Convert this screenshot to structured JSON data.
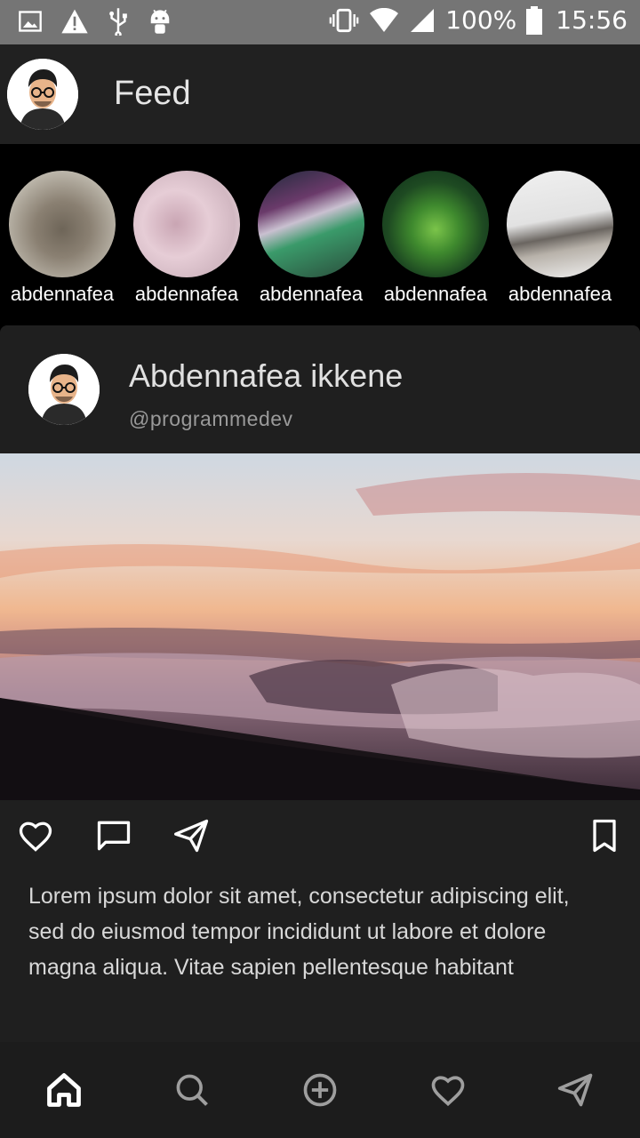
{
  "status_bar": {
    "battery": "100%",
    "time": "15:56",
    "left_icons": [
      "image-icon",
      "warning-icon",
      "usb-icon",
      "android-icon"
    ],
    "right_icons": [
      "vibrate-icon",
      "wifi-icon",
      "signal-icon",
      "battery-icon"
    ]
  },
  "app_bar": {
    "title": "Feed"
  },
  "stories": [
    {
      "name": "abdennafea"
    },
    {
      "name": "abdennafea"
    },
    {
      "name": "abdennafea"
    },
    {
      "name": "abdennafea"
    },
    {
      "name": "abdennafea"
    }
  ],
  "post": {
    "author": "Abdennafea ikkene",
    "handle": "@programmedev",
    "caption": "Lorem ipsum dolor sit amet, consectetur adipiscing elit, sed do eiusmod tempor incididunt ut labore et dolore magna aliqua. Vitae sapien pellentesque habitant",
    "actions": [
      "heart-icon",
      "comment-icon",
      "send-icon",
      "bookmark-icon"
    ]
  },
  "bottom_nav": [
    "home-icon",
    "search-icon",
    "add-icon",
    "heart-icon",
    "send-icon"
  ],
  "colors": {
    "status_bar": "#757575",
    "app_bar": "#212121",
    "card": "#1f1f1f",
    "bottom_nav": "#1c1c1c"
  }
}
